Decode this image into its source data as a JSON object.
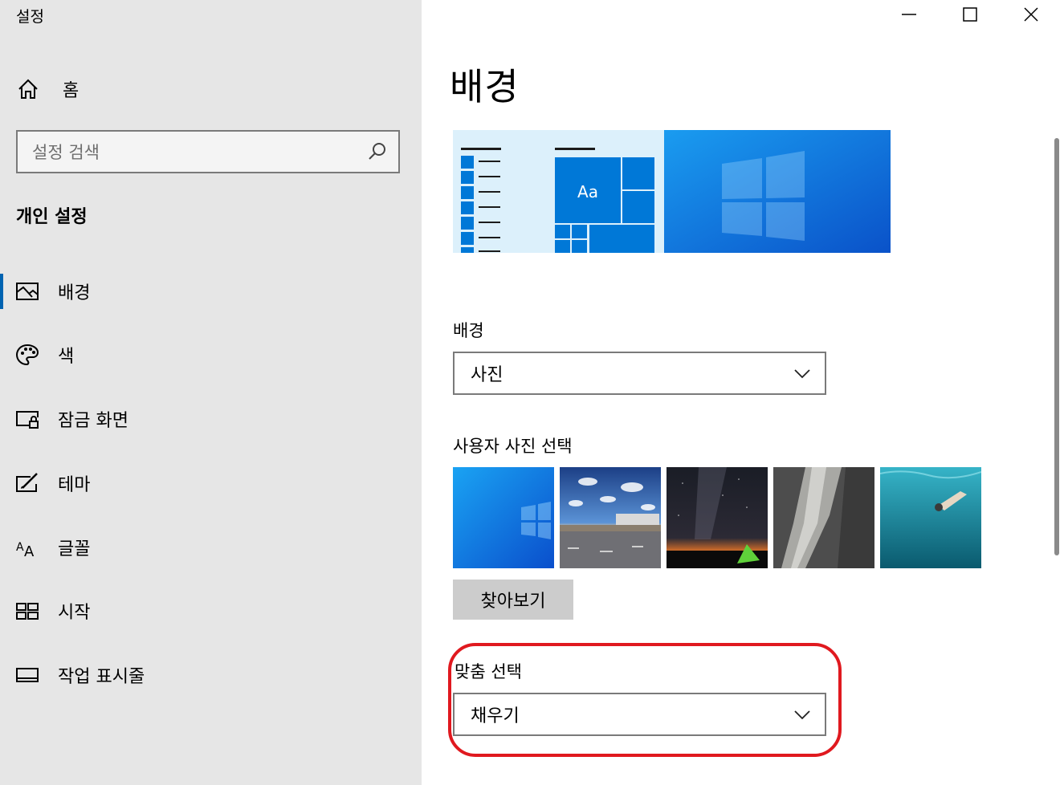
{
  "window": {
    "title": "설정",
    "controls": [
      "minimize-icon",
      "maximize-icon",
      "close-icon"
    ]
  },
  "nav": {
    "home_label": "홈",
    "search_placeholder": "설정 검색",
    "section_title": "개인 설정",
    "items": [
      {
        "label": "배경",
        "icon": "picture-icon",
        "active": true
      },
      {
        "label": "색",
        "icon": "palette-icon",
        "active": false
      },
      {
        "label": "잠금 화면",
        "icon": "lock-screen-icon",
        "active": false
      },
      {
        "label": "테마",
        "icon": "theme-icon",
        "active": false
      },
      {
        "label": "글꼴",
        "icon": "font-icon",
        "active": false
      },
      {
        "label": "시작",
        "icon": "start-icon",
        "active": false
      },
      {
        "label": "작업 표시줄",
        "icon": "taskbar-icon",
        "active": false
      }
    ]
  },
  "main": {
    "page_title": "배경",
    "preview": {
      "tile_text": "Aa"
    },
    "background": {
      "label": "배경",
      "value": "사진"
    },
    "photos": {
      "label": "사용자 사진 선택",
      "thumbnails": [
        "windows-wallpaper",
        "airport-sky",
        "milky-way-tent",
        "rock-cliff",
        "underwater-swimmer"
      ]
    },
    "browse_label": "찾아보기",
    "fit": {
      "label": "맞춤 선택",
      "value": "채우기"
    }
  },
  "colors": {
    "nav_bg": "#e6e6e6",
    "accent": "#0063b1",
    "highlight": "#e0191f"
  }
}
